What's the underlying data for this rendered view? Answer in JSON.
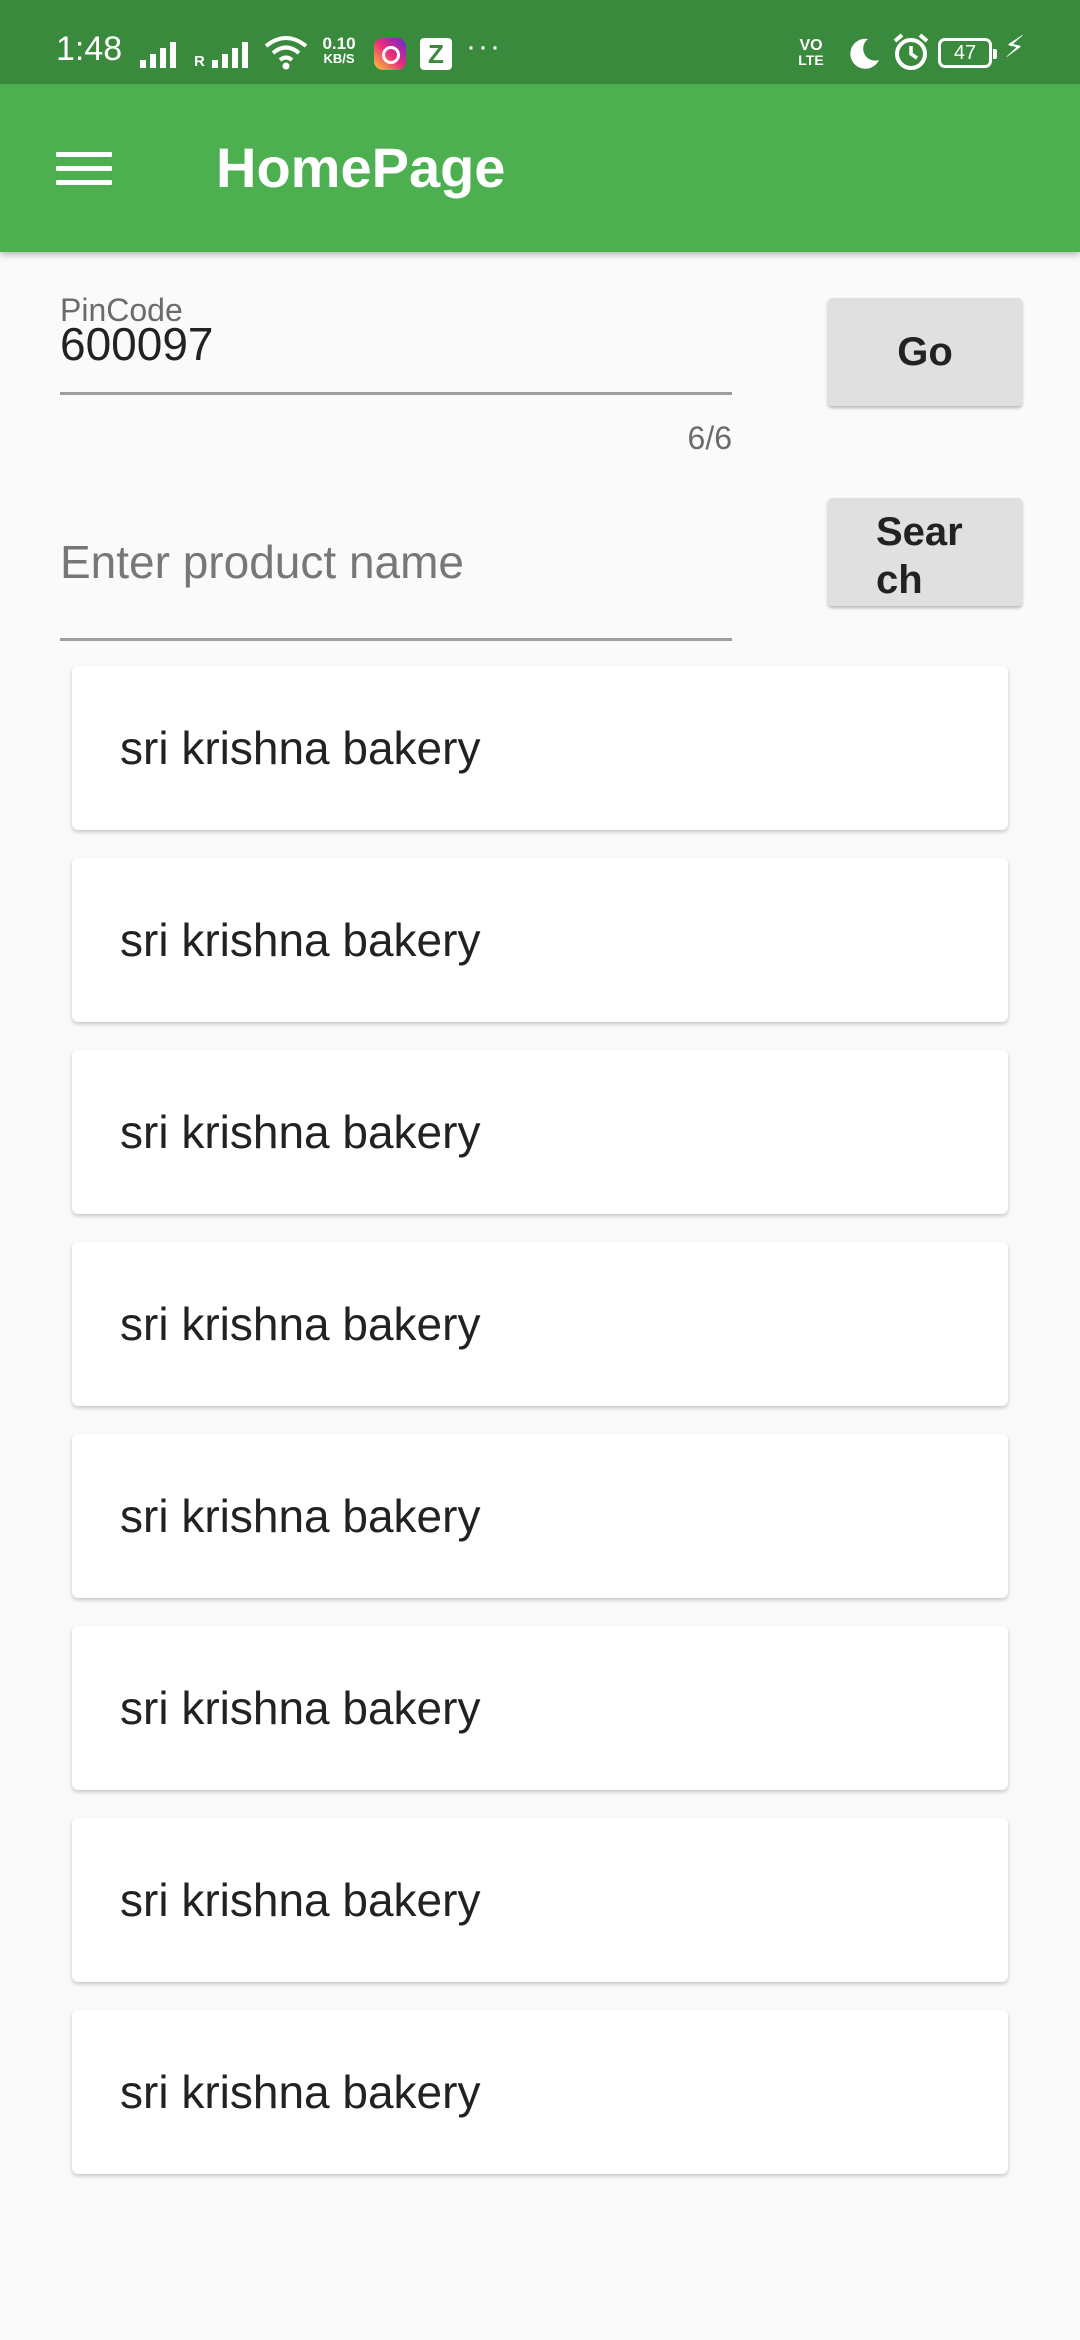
{
  "status_bar": {
    "time": "1:48",
    "net_speed_top": "0.10",
    "net_speed_bottom": "KB/S",
    "roaming": "R",
    "volte_top": "VO",
    "volte_bottom": "LTE",
    "battery": "47"
  },
  "app_bar": {
    "title": "HomePage",
    "menu_icon": "hamburger-menu-icon"
  },
  "pincode": {
    "label": "PinCode",
    "value": "600097",
    "counter": "6/6"
  },
  "buttons": {
    "go": "Go",
    "search": "Search"
  },
  "product_search": {
    "placeholder": "Enter product name",
    "value": ""
  },
  "results": [
    {
      "name": "sri krishna bakery"
    },
    {
      "name": "sri krishna bakery"
    },
    {
      "name": "sri krishna bakery"
    },
    {
      "name": "sri krishna bakery"
    },
    {
      "name": "sri krishna bakery"
    },
    {
      "name": "sri krishna bakery"
    },
    {
      "name": "sri krishna bakery"
    },
    {
      "name": "sri krishna bakery"
    }
  ],
  "colors": {
    "app_bar": "#4caf50",
    "status_bar": "#3a8a3e",
    "background": "#fafafa"
  }
}
